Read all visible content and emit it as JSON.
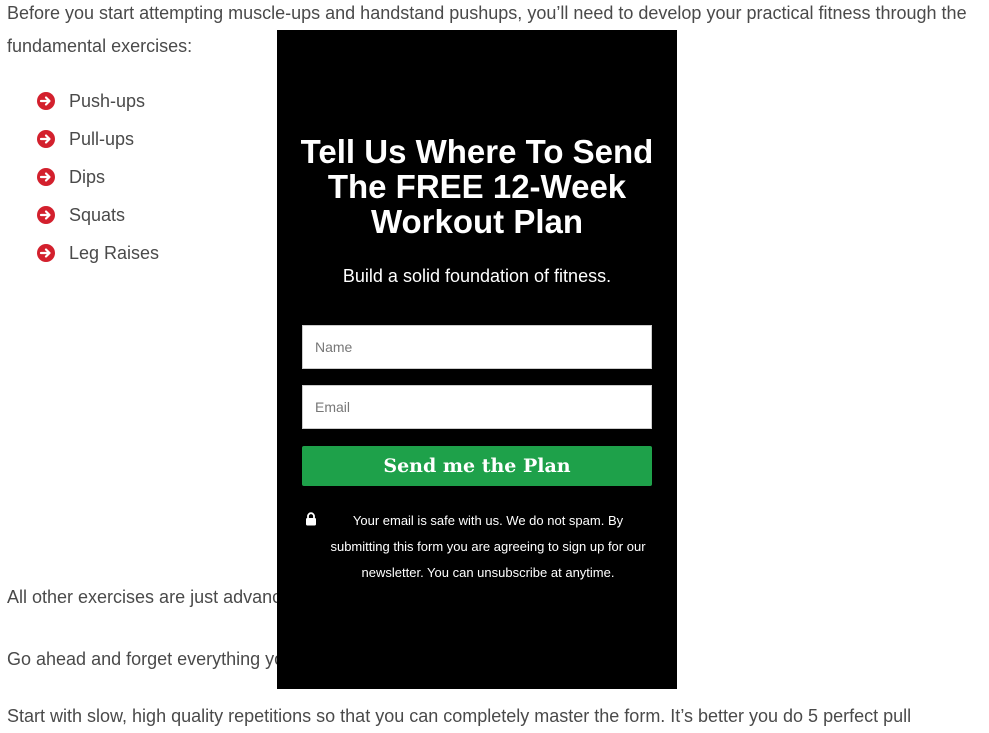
{
  "article": {
    "intro": "Before you start attempting muscle-ups and handstand pushups, you’ll need to develop your practical fitness through the fundamental exercises:",
    "exercises": [
      "Push-ups",
      "Pull-ups",
      "Dips",
      "Squats",
      "Leg Raises"
    ],
    "p_other": "All other exercises are just advanced variations of these fundamental exercises.",
    "p_ahead": "Go ahead and forget everything you know about fitness and start from scratch.",
    "p_start": "Start with slow, high quality repetitions so that you can completely master the form. It’s better you do 5 perfect pull"
  },
  "modal": {
    "title": "Tell Us Where To Send The FREE 12-Week Workout Plan",
    "subtitle": "Build a solid foundation of fitness.",
    "name_placeholder": "Name",
    "email_placeholder": "Email",
    "submit_label": "Send me the Plan",
    "disclaimer": "Your email is safe with us. We do not spam. By submitting this form you are agreeing to sign up for our newsletter. You can unsubscribe at anytime."
  },
  "colors": {
    "overlay": "#000000",
    "accent_green": "#1ea14a",
    "bullet_red": "#d3202d"
  },
  "icons": {
    "bullet": "arrow-circle-right-icon",
    "disclaimer": "lock-icon"
  }
}
